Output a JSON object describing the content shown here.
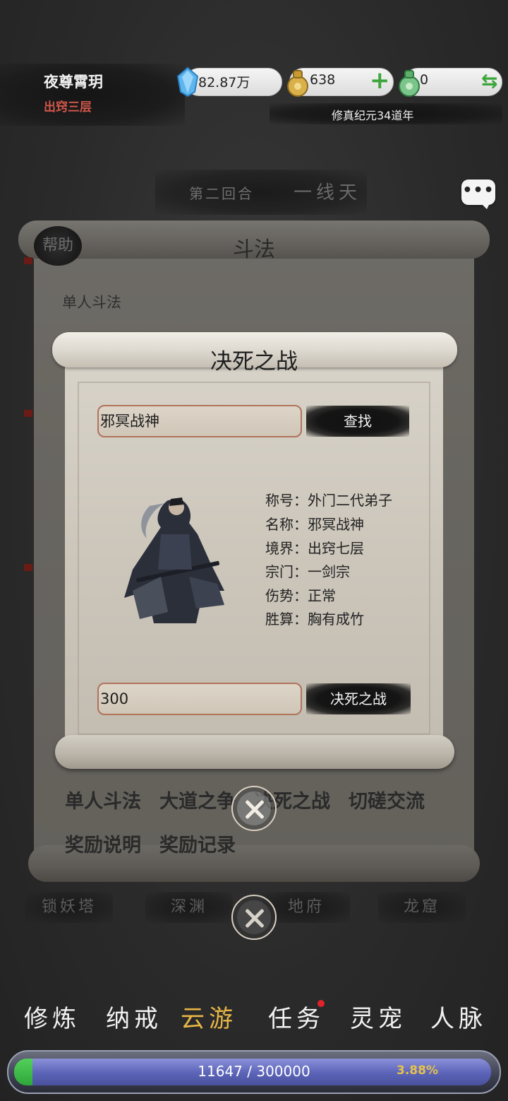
{
  "player": {
    "name": "夜尊霄玥",
    "realm": "出窍三层"
  },
  "resources": {
    "spirit_stone": {
      "value": "82.87万",
      "icon": "crystal-icon"
    },
    "gold": {
      "value": "638",
      "icon": "gold-bag-icon",
      "action": "+"
    },
    "jade": {
      "value": "0",
      "icon": "jade-bag-icon",
      "action": "⇆"
    }
  },
  "date": "修真纪元34道年",
  "round": {
    "label": "第二回合",
    "name": "一线天"
  },
  "chat_icon": "chat-icon",
  "outer_dialog": {
    "title": "斗法",
    "help": "帮助",
    "subtitle": "单人斗法",
    "tabs": [
      "单人斗法",
      "大道之争",
      "决死之战",
      "切磋交流",
      "奖励说明",
      "奖励记录"
    ]
  },
  "inner_dialog": {
    "title": "决死之战",
    "search_value": "邪冥战神",
    "search_button": "查找",
    "info": [
      {
        "label": "称号：",
        "value": "外门二代弟子"
      },
      {
        "label": "名称：",
        "value": "邪冥战神"
      },
      {
        "label": "境界：",
        "value": "出窍七层"
      },
      {
        "label": "宗门：",
        "value": "一剑宗"
      },
      {
        "label": "伤势：",
        "value": "正常"
      },
      {
        "label": "胜算：",
        "value": "胸有成竹"
      }
    ],
    "stake_value": "300",
    "fight_button": "决死之战"
  },
  "map_labels": [
    "锁妖塔",
    "深渊",
    "地府",
    "龙窟"
  ],
  "nav": {
    "items": [
      "修炼",
      "纳戒",
      "云游",
      "任务",
      "灵宠",
      "人脉"
    ],
    "active_index": 2
  },
  "xp": {
    "text": "11647 / 300000",
    "percent": "3.88%",
    "fraction": 0.0388
  },
  "colors": {
    "accent": "#e6b546",
    "realm_red": "#d0564a",
    "xp_green": "#2fa63a",
    "xp_blue": "#5b63b8"
  }
}
